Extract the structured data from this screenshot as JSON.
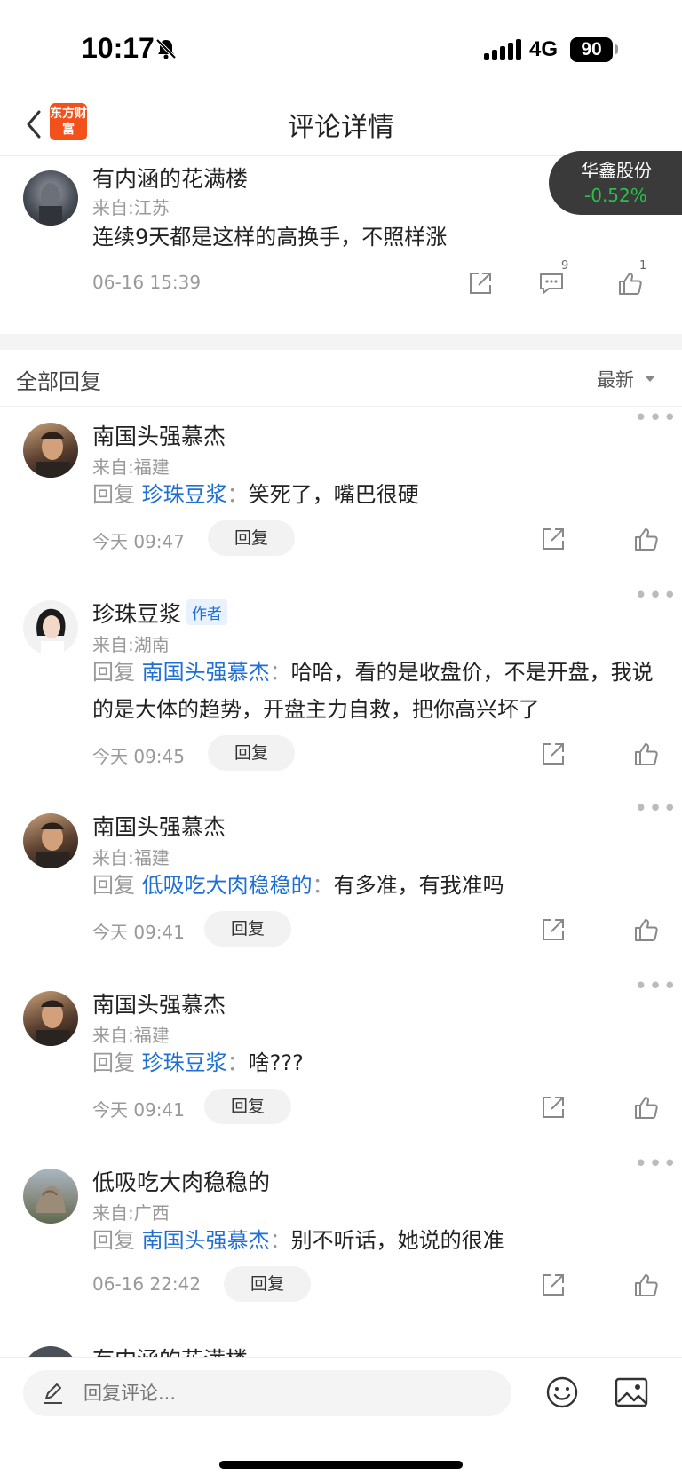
{
  "status_bar": {
    "time": "10:17",
    "network": "4G",
    "battery": "90"
  },
  "nav": {
    "logo_text": "东方财富",
    "title": "评论详情"
  },
  "stock": {
    "name": "华鑫股份",
    "change": "-0.52%"
  },
  "main_comment": {
    "user": "有内涵的花满楼",
    "location": "来自:江苏",
    "text": "连续9天都是这样的高换手，不照样涨",
    "time": "06-16 15:39",
    "comment_count": "9",
    "like_count": "1"
  },
  "replies_header": {
    "title": "全部回复",
    "sort": "最新"
  },
  "reply_prefix": "回复",
  "reply_button": "回复",
  "author_badge": "作者",
  "replies": [
    {
      "user": "南国头强慕杰",
      "location": "来自:福建",
      "to": "珍珠豆浆",
      "text": "笑死了，嘴巴很硬",
      "time": "今天 09:47"
    },
    {
      "user": "珍珠豆浆",
      "location": "来自:湖南",
      "to": "南国头强慕杰",
      "text": "哈哈，看的是收盘价，不是开盘，我说的是大体的趋势，开盘主力自救，把你高兴坏了",
      "time": "今天 09:45"
    },
    {
      "user": "南国头强慕杰",
      "location": "来自:福建",
      "to": "低吸吃大肉稳稳的",
      "text": "有多准，有我准吗",
      "time": "今天 09:41"
    },
    {
      "user": "南国头强慕杰",
      "location": "来自:福建",
      "to": "珍珠豆浆",
      "text": "啥???",
      "time": "今天 09:41"
    },
    {
      "user": "低吸吃大肉稳稳的",
      "location": "来自:广西",
      "to": "南国头强慕杰",
      "text": "别不听话，她说的很准",
      "time": "06-16 22:42"
    }
  ],
  "partial_next_user": "有内涵的花满楼",
  "bottom_bar": {
    "placeholder": "回复评论..."
  },
  "colors": {
    "brand": "#f2511c",
    "link": "#1f6fd6",
    "stock_down": "#27c24c"
  }
}
